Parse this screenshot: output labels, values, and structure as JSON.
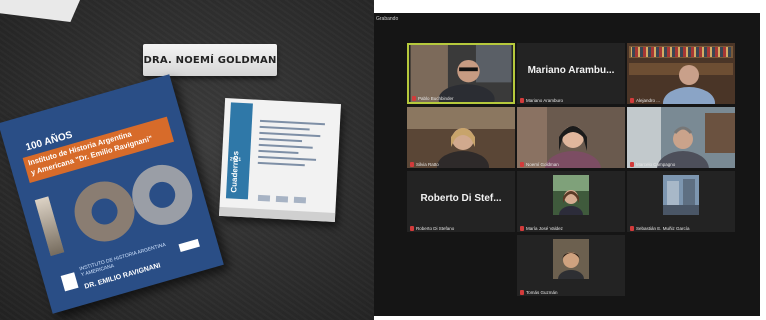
{
  "photo": {
    "name_card": "DRA. NOEMÍ GOLDMAN",
    "blue_book": {
      "anos": "100 AÑOS",
      "title_line1": "Instituto de Historia Argentina",
      "title_line2": "y Americana \"Dr. Emilio Ravignani\"",
      "footer_institute": "INSTITUTO DE HISTORIA ARGENTINA Y AMERICANA",
      "footer_name": "DR. EMILIO RAVIGNANI"
    },
    "white_book": {
      "spine_title": "Cuadernos",
      "year": "2021"
    }
  },
  "zoom": {
    "title": "Grabando",
    "speaker_color": "#b6c93c",
    "participants": [
      {
        "label": "Pablo Buchbinder",
        "video": true,
        "speaker": true
      },
      {
        "label": "Mariano Aramburo",
        "name_only": "Mariano Arambu...",
        "video": false
      },
      {
        "label": "Alejandro ...",
        "video": true
      },
      {
        "label": "Silvia Ratto",
        "video": true
      },
      {
        "label": "Noemí Goldman",
        "video": true
      },
      {
        "label": "Marcelo Campagno",
        "video": true
      },
      {
        "label": "Roberto Di Stefano",
        "name_only": "Roberto Di Stef...",
        "video": false
      },
      {
        "label": "María José Valdez",
        "video": true,
        "small": true
      },
      {
        "label": "Sebastián E. Muñiz García",
        "video": true,
        "small": true
      },
      {
        "label": "Tomás Guzmán",
        "video": true,
        "small": true
      }
    ]
  }
}
